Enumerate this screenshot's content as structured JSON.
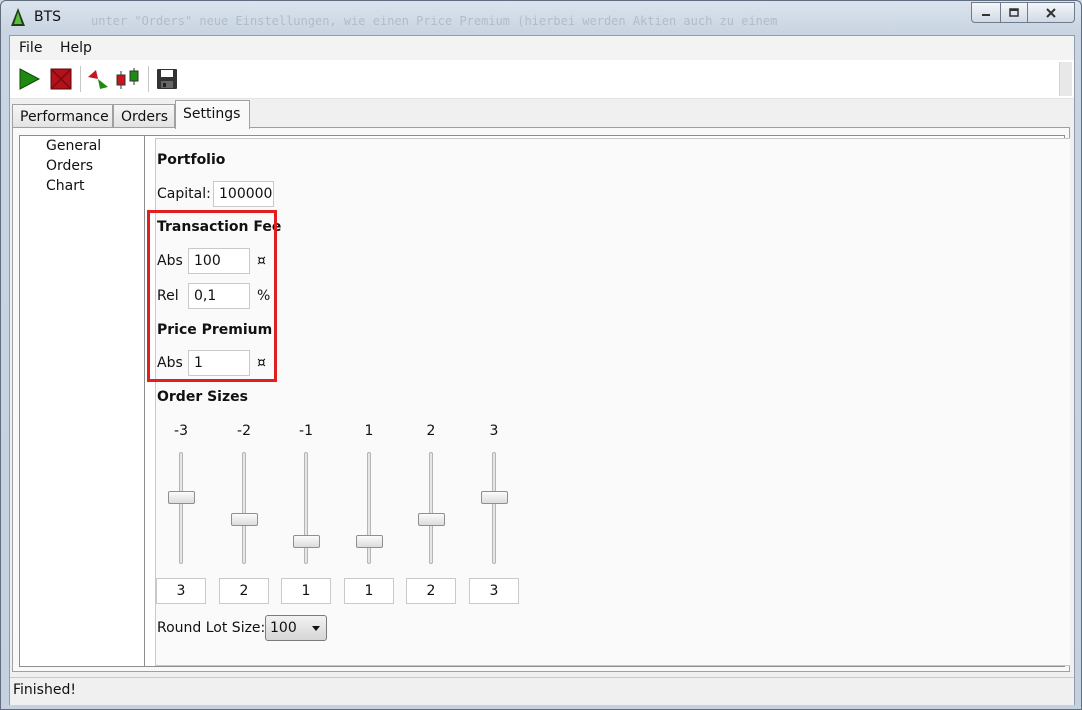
{
  "window": {
    "title": "BTS",
    "background_text": "unter \"Orders\" neue Einstellungen, wie einen Price Premium (hierbei werden Aktien auch zu einem"
  },
  "menu": {
    "file": "File",
    "help": "Help"
  },
  "toolbar": {
    "icons": [
      "play-icon",
      "stop-icon",
      "trade-arrows-icon",
      "candlestick-chart-icon",
      "save-icon"
    ]
  },
  "tabs": {
    "performance": "Performance",
    "orders": "Orders",
    "settings": "Settings",
    "active": "Settings"
  },
  "tree": {
    "items": [
      "General",
      "Orders",
      "Chart"
    ]
  },
  "settings": {
    "portfolio": {
      "heading": "Portfolio",
      "capital_label": "Capital:",
      "capital_value": "100000"
    },
    "transaction_fee": {
      "heading": "Transaction Fee",
      "abs_label": "Abs",
      "abs_value": "100",
      "abs_unit": "¤",
      "rel_label": "Rel",
      "rel_value": "0,1",
      "rel_unit": "%"
    },
    "price_premium": {
      "heading": "Price Premium",
      "abs_label": "Abs",
      "abs_value": "1",
      "abs_unit": "¤"
    },
    "order_sizes": {
      "heading": "Order Sizes",
      "columns": [
        {
          "label": "-3",
          "value": "3",
          "level": 3
        },
        {
          "label": "-2",
          "value": "2",
          "level": 2
        },
        {
          "label": "-1",
          "value": "1",
          "level": 1
        },
        {
          "label": "1",
          "value": "1",
          "level": 1
        },
        {
          "label": "2",
          "value": "2",
          "level": 2
        },
        {
          "label": "3",
          "value": "3",
          "level": 3
        }
      ]
    },
    "round_lot": {
      "label": "Round Lot Size:",
      "value": "100"
    }
  },
  "status": {
    "text": "Finished!"
  },
  "colors": {
    "highlight": "#e02020",
    "play": "#1f8a12",
    "stop": "#b3121a"
  }
}
